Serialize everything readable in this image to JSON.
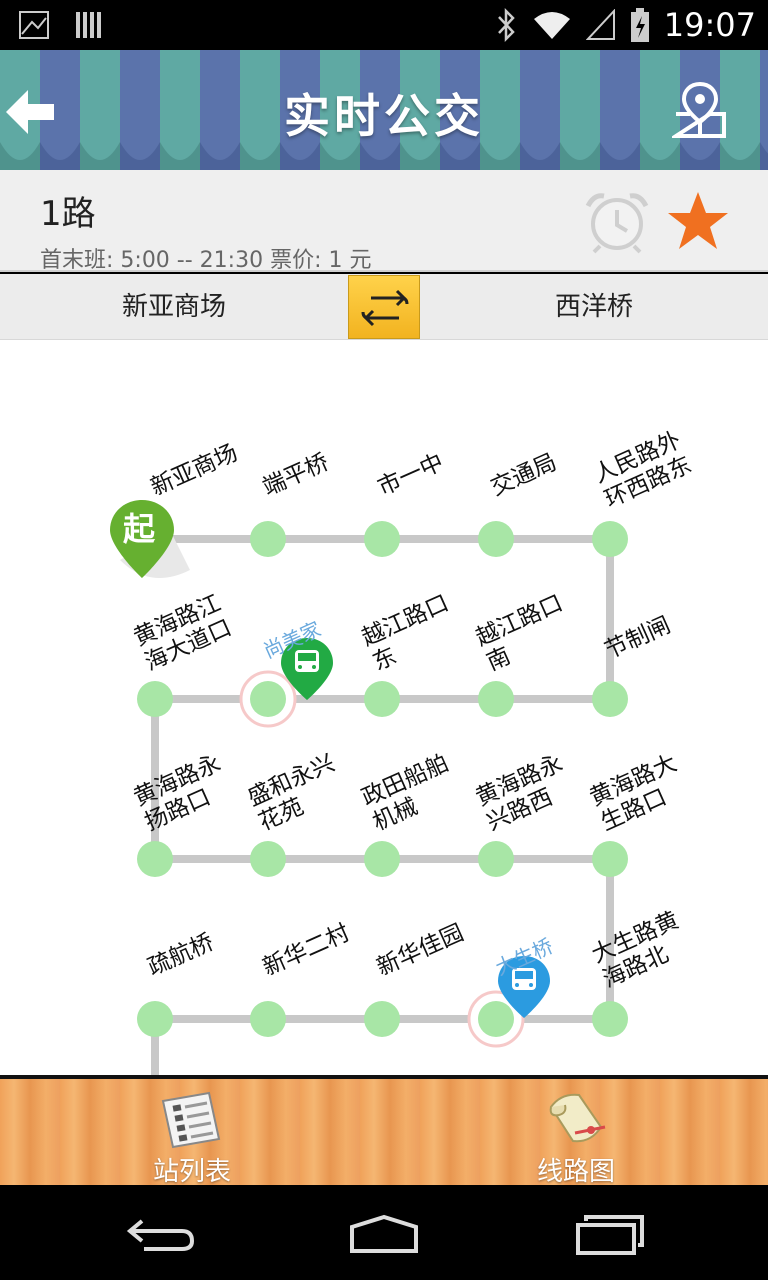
{
  "status_bar": {
    "time": "19:07",
    "icons": [
      "gallery-icon",
      "signal-bars-icon",
      "bluetooth-icon",
      "wifi-icon",
      "battery-icon"
    ]
  },
  "header": {
    "title": "实时公交",
    "back_icon": "back-arrow-icon",
    "map_icon": "map-pin-icon"
  },
  "route": {
    "name": "1路",
    "schedule": "首末班: 5:00 -- 21:30 票价: 1 元"
  },
  "direction": {
    "from": "新亚商场",
    "to": "西洋桥"
  },
  "start_marker": "起",
  "stops": [
    {
      "name": "新亚商场"
    },
    {
      "name": "端平桥"
    },
    {
      "name": "市一中"
    },
    {
      "name": "交通局"
    },
    {
      "name": "人民路外\n环西路东"
    },
    {
      "name": "节制闸"
    },
    {
      "name": "越江路口\n南"
    },
    {
      "name": "越江路口\n东"
    },
    {
      "name": "尚美家"
    },
    {
      "name": "黄海路江\n海大道口"
    },
    {
      "name": "黄海路永\n扬路口"
    },
    {
      "name": "盛和永兴\n花苑"
    },
    {
      "name": "政田船舶\n机械"
    },
    {
      "name": "黄海路永\n兴路西"
    },
    {
      "name": "黄海路大\n生路口"
    },
    {
      "name": "大生路黄\n海路北"
    },
    {
      "name": "大生桥"
    },
    {
      "name": "新华佳园"
    },
    {
      "name": "新华二村"
    },
    {
      "name": "疏航桥"
    }
  ],
  "buses": [
    {
      "label": "尚美家",
      "color": "#22aa44"
    },
    {
      "label": "大生桥",
      "color": "#2b9be0"
    }
  ],
  "tabs": [
    {
      "label": "站列表",
      "icon": "list-icon"
    },
    {
      "label": "线路图",
      "icon": "scroll-map-icon"
    }
  ],
  "colors": {
    "stop": "#a8e6a6",
    "line": "#c8c8c8",
    "header_teal": "#5fa9a3",
    "header_blue": "#5b73ab",
    "star": "#f07020"
  }
}
